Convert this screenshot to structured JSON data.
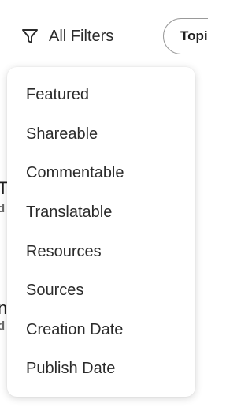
{
  "toolbar": {
    "filters_label": "All Filters",
    "topic_pill_label": "Topi"
  },
  "background": {
    "fragment_1": "T",
    "fragment_1_sub": "d",
    "fragment_2": "n",
    "fragment_2_sub": "d"
  },
  "menu": {
    "items": [
      {
        "label": "Featured"
      },
      {
        "label": "Shareable"
      },
      {
        "label": "Commentable"
      },
      {
        "label": "Translatable"
      },
      {
        "label": "Resources"
      },
      {
        "label": "Sources"
      },
      {
        "label": "Creation Date"
      },
      {
        "label": "Publish Date"
      }
    ]
  },
  "icons": {
    "filter": "filter-funnel-icon"
  },
  "colors": {
    "text": "#2b2b2b",
    "pill_border": "#9a9a9a",
    "menu_bg": "#ffffff"
  }
}
